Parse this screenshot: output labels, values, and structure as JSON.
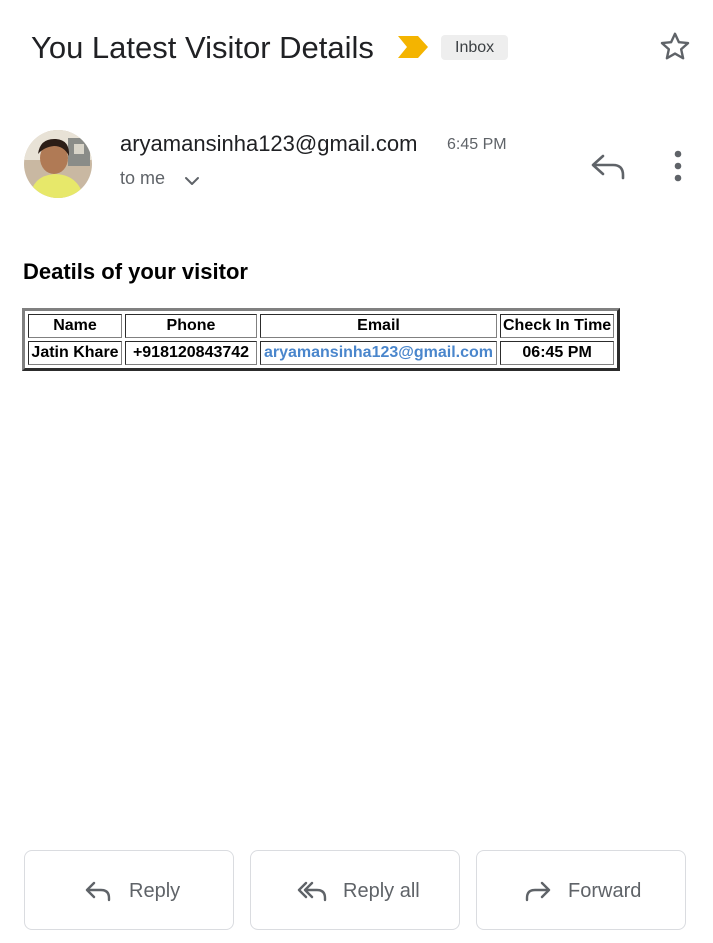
{
  "subject": {
    "title": "You Latest Visitor Details",
    "label": "Inbox",
    "importance_marker_color": "#f4b400"
  },
  "message": {
    "sender_email": "aryamansinha123@gmail.com",
    "time": "6:45 PM",
    "recipient": "to me",
    "icons": [
      "star-icon",
      "reply-icon",
      "more-vert-icon",
      "chevron-down-icon"
    ]
  },
  "body": {
    "heading": "Deatils of your visitor",
    "table": {
      "headers": [
        "Name",
        "Phone",
        "Email",
        "Check In Time"
      ],
      "rows": [
        [
          "Jatin Khare",
          "+918120843742",
          "aryamansinha123@gmail.com",
          "06:45 PM"
        ]
      ],
      "link_color": "#4a86cc"
    }
  },
  "actions": {
    "reply": "Reply",
    "reply_all": "Reply all",
    "forward": "Forward"
  }
}
